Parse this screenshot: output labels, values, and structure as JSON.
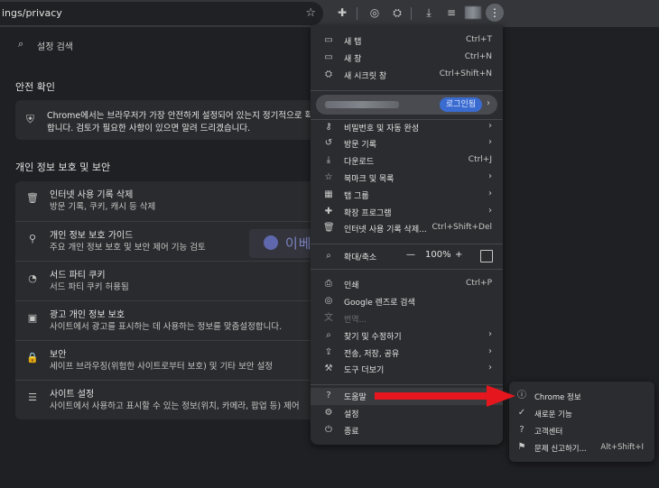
{
  "toolbar": {
    "url": "ings/privacy",
    "icons": [
      "star-icon",
      "extension-icon",
      "lens-icon",
      "incognito-icon",
      "download-icon",
      "reading-list-icon",
      "avatar",
      "menu-icon"
    ]
  },
  "settings": {
    "search_placeholder": "설정 검색",
    "safety_title": "안전 확인",
    "safety_line1": "Chrome에서는 브라우저가 가장 안전하게 설정되어 있는지 정기적으로 확인",
    "safety_line2": "합니다. 검토가 필요한 사항이 있으면 알려 드리겠습니다.",
    "privacy_title": "개인 정보 보호 및 보안",
    "rows": [
      {
        "icon": "trash-icon",
        "glyph": "🗑",
        "title": "인터넷 사용 기록 삭제",
        "desc": "방문 기록, 쿠키, 캐시 등 삭제"
      },
      {
        "icon": "guide-icon",
        "glyph": "⚲",
        "title": "개인 정보 보호 가이드",
        "desc": "주요 개인 정보 보호 및 보안 제어 기능 검토"
      },
      {
        "icon": "cookie-icon",
        "glyph": "◔",
        "title": "서드 파티 쿠키",
        "desc": "서드 파티 쿠키 허용됨"
      },
      {
        "icon": "ad-privacy-icon",
        "glyph": "▣",
        "title": "광고 개인 정보 보호",
        "desc": "사이트에서 광고를 표시하는 데 사용하는 정보를 맞춤설정합니다."
      },
      {
        "icon": "lock-icon",
        "glyph": "🔒",
        "title": "보안",
        "desc": "세이프 브라우징(위험한 사이트로부터 보호) 및 기타 보안 설정"
      },
      {
        "icon": "site-settings-icon",
        "glyph": "☰",
        "title": "사이트 설정",
        "desc": "사이트에서 사용하고 표시할 수 있는 정보(위치, 카메라, 팝업 등) 제어"
      }
    ]
  },
  "watermark": {
    "text": "이베이스매뉴얼"
  },
  "menu": {
    "items_top": [
      {
        "icon": "new-tab-icon",
        "glyph": "▭",
        "label": "새 탭",
        "shortcut": "Ctrl+T"
      },
      {
        "icon": "new-window-icon",
        "glyph": "▭",
        "label": "새 창",
        "shortcut": "Ctrl+N"
      },
      {
        "icon": "incognito-icon",
        "glyph": "⛭",
        "label": "새 시크릿 창",
        "shortcut": "Ctrl+Shift+N"
      }
    ],
    "profile": {
      "login_label": "로그인됨"
    },
    "items_mid": [
      {
        "icon": "key-icon",
        "glyph": "⚷",
        "label": "비밀번호 및 자동 완성",
        "shortcut": "",
        "arrow": true
      },
      {
        "icon": "history-icon",
        "glyph": "↺",
        "label": "방문 기록",
        "shortcut": "",
        "arrow": true
      },
      {
        "icon": "download-icon",
        "glyph": "⤓",
        "label": "다운로드",
        "shortcut": "Ctrl+J",
        "arrow": false
      },
      {
        "icon": "bookmark-icon",
        "glyph": "☆",
        "label": "북마크 및 목록",
        "shortcut": "",
        "arrow": true
      },
      {
        "icon": "tab-groups-icon",
        "glyph": "▦",
        "label": "탭 그룹",
        "shortcut": "",
        "arrow": true
      },
      {
        "icon": "extension-icon",
        "glyph": "✚",
        "label": "확장 프로그램",
        "shortcut": "",
        "arrow": true
      },
      {
        "icon": "trash-icon",
        "glyph": "🗑",
        "label": "인터넷 사용 기록 삭제...",
        "shortcut": "Ctrl+Shift+Del",
        "arrow": false
      }
    ],
    "zoom": {
      "label": "확대/축소",
      "minus": "—",
      "value": "100%",
      "plus": "+"
    },
    "items_bottom": [
      {
        "icon": "print-icon",
        "glyph": "⎙",
        "label": "인쇄",
        "shortcut": "Ctrl+P",
        "arrow": false,
        "dim": false
      },
      {
        "icon": "google-lens-icon",
        "glyph": "◎",
        "label": "Google 렌즈로 검색",
        "shortcut": "",
        "arrow": false,
        "dim": false
      },
      {
        "icon": "translate-icon",
        "glyph": "文",
        "label": "번역...",
        "shortcut": "",
        "arrow": false,
        "dim": true
      },
      {
        "icon": "find-edit-icon",
        "glyph": "⌕",
        "label": "찾기 및 수정하기",
        "shortcut": "",
        "arrow": true,
        "dim": false
      },
      {
        "icon": "share-icon",
        "glyph": "⇪",
        "label": "전송, 저장, 공유",
        "shortcut": "",
        "arrow": true,
        "dim": false
      },
      {
        "icon": "tools-icon",
        "glyph": "⚒",
        "label": "도구 더보기",
        "shortcut": "",
        "arrow": true,
        "dim": false
      }
    ],
    "items_end": [
      {
        "icon": "help-icon",
        "glyph": "?",
        "label": "도움말",
        "shortcut": "",
        "arrow": true,
        "hi": true
      },
      {
        "icon": "settings-icon",
        "glyph": "⚙",
        "label": "설정",
        "shortcut": "",
        "arrow": false,
        "hi": false
      },
      {
        "icon": "exit-icon",
        "glyph": "⏻",
        "label": "종료",
        "shortcut": "",
        "arrow": false,
        "hi": false
      }
    ]
  },
  "submenu": {
    "items": [
      {
        "icon": "info-icon",
        "glyph": "ⓘ",
        "label": "Chrome 정보",
        "shortcut": ""
      },
      {
        "icon": "whats-new-icon",
        "glyph": "✓",
        "label": "새로운 기능",
        "shortcut": ""
      },
      {
        "icon": "help-center-icon",
        "glyph": "?",
        "label": "고객센터",
        "shortcut": ""
      },
      {
        "icon": "report-issue-icon",
        "glyph": "⚑",
        "label": "문제 신고하기...",
        "shortcut": "Alt+Shift+I"
      }
    ]
  },
  "colors": {
    "accent_arrow": "#e5161d",
    "login_badge": "#3a6bd0",
    "menu_bg": "#2b2c2f"
  }
}
